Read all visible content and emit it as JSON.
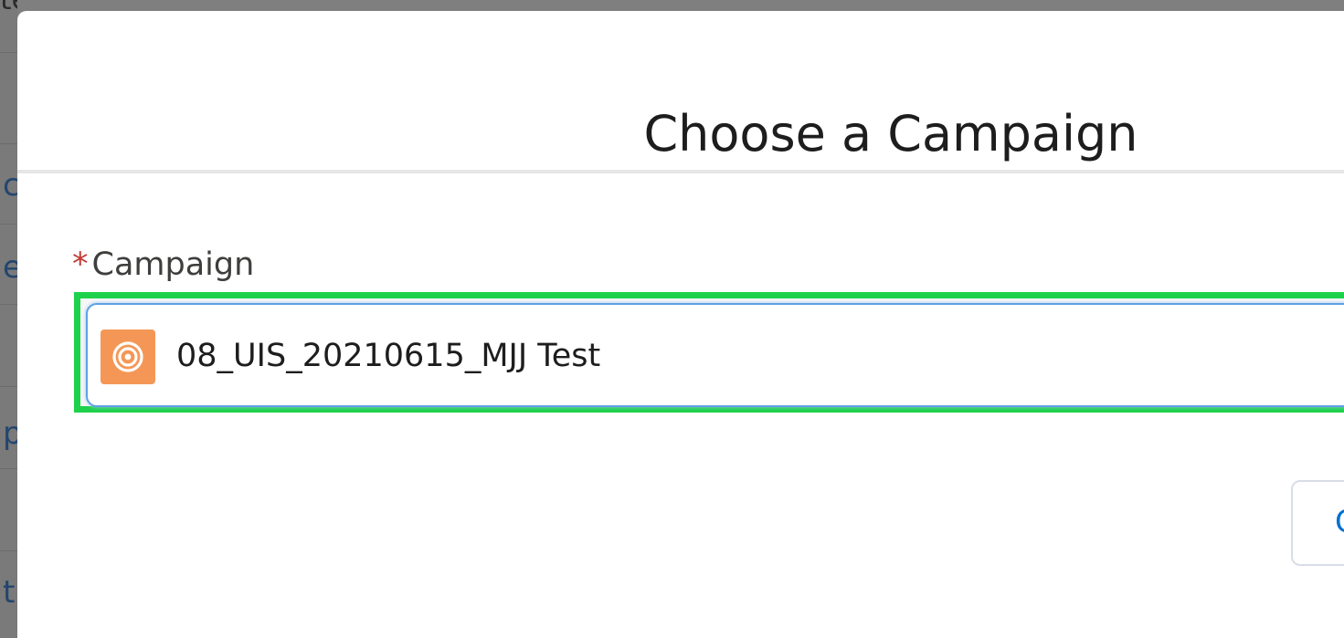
{
  "background": {
    "top_text": "ted a few seconds ago",
    "edge_chars": [
      "c",
      "e",
      "p",
      "t"
    ]
  },
  "modal": {
    "title": "Choose a Campaign",
    "field": {
      "required_marker": "*",
      "label": "Campaign",
      "value": "08_UIS_20210615_MJJ Test",
      "icon": "campaign-target-icon"
    },
    "button_label_partial": "C"
  },
  "colors": {
    "highlight": "#1ed14b",
    "campaign_icon_bg": "#f49756",
    "required": "#c23934",
    "focus_border": "#5fa0e6"
  }
}
